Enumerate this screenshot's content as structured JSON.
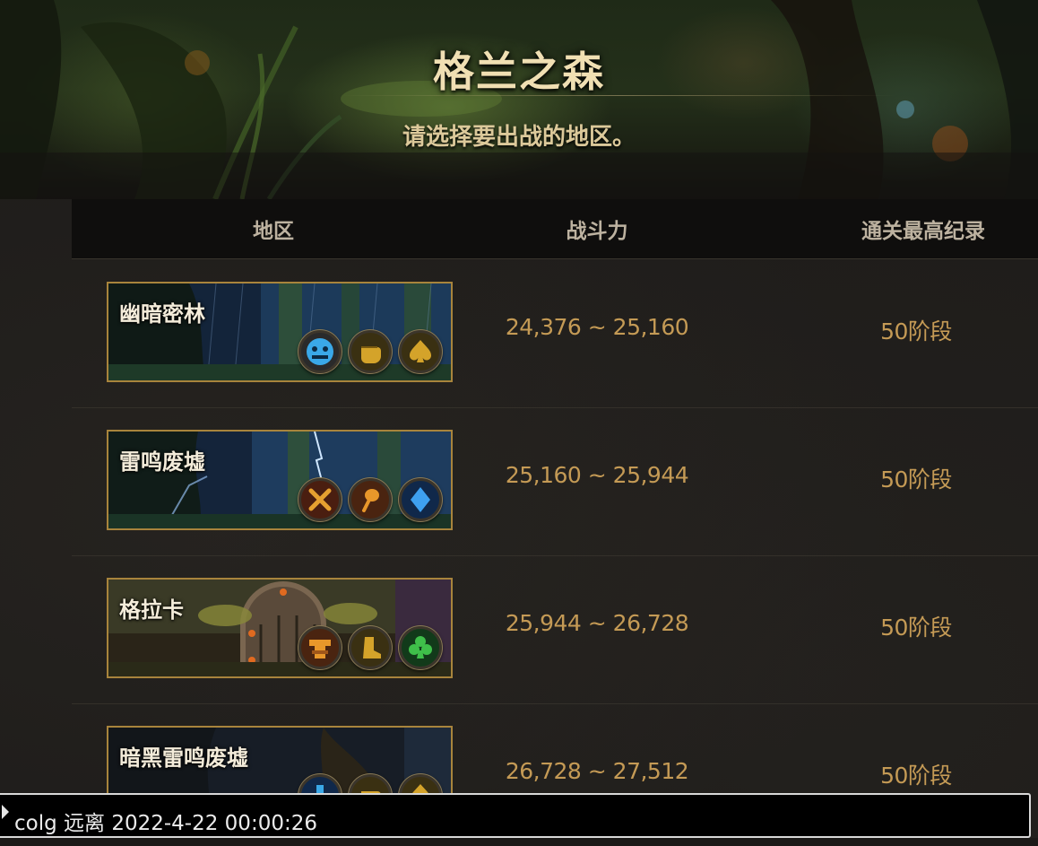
{
  "banner": {
    "title": "格兰之森",
    "subtitle": "请选择要出战的地区。"
  },
  "table": {
    "headers": {
      "area": "地区",
      "power": "战斗力",
      "record": "通关最高纪录"
    },
    "rows": [
      {
        "name": "幽暗密林",
        "power": "24,376 ~ 25,160",
        "record": "50阶段",
        "icons": [
          "blue-mask-icon",
          "fist-icon",
          "spade-icon"
        ]
      },
      {
        "name": "雷鸣废墟",
        "power": "25,160 ~ 25,944",
        "record": "50阶段",
        "icons": [
          "crossed-swords-icon",
          "torch-icon",
          "diamond-icon"
        ]
      },
      {
        "name": "格拉卡",
        "power": "25,944 ~ 26,728",
        "record": "50阶段",
        "icons": [
          "totem-icon",
          "boot-icon",
          "club-icon"
        ]
      },
      {
        "name": "暗黑雷鸣废墟",
        "power": "26,728 ~ 27,512",
        "record": "50阶段",
        "icons": [
          "blue-mask-icon",
          "fist-icon",
          "spade-icon"
        ]
      }
    ]
  },
  "chat": {
    "text": "colg 远离 2022-4-22 00:00:26"
  }
}
